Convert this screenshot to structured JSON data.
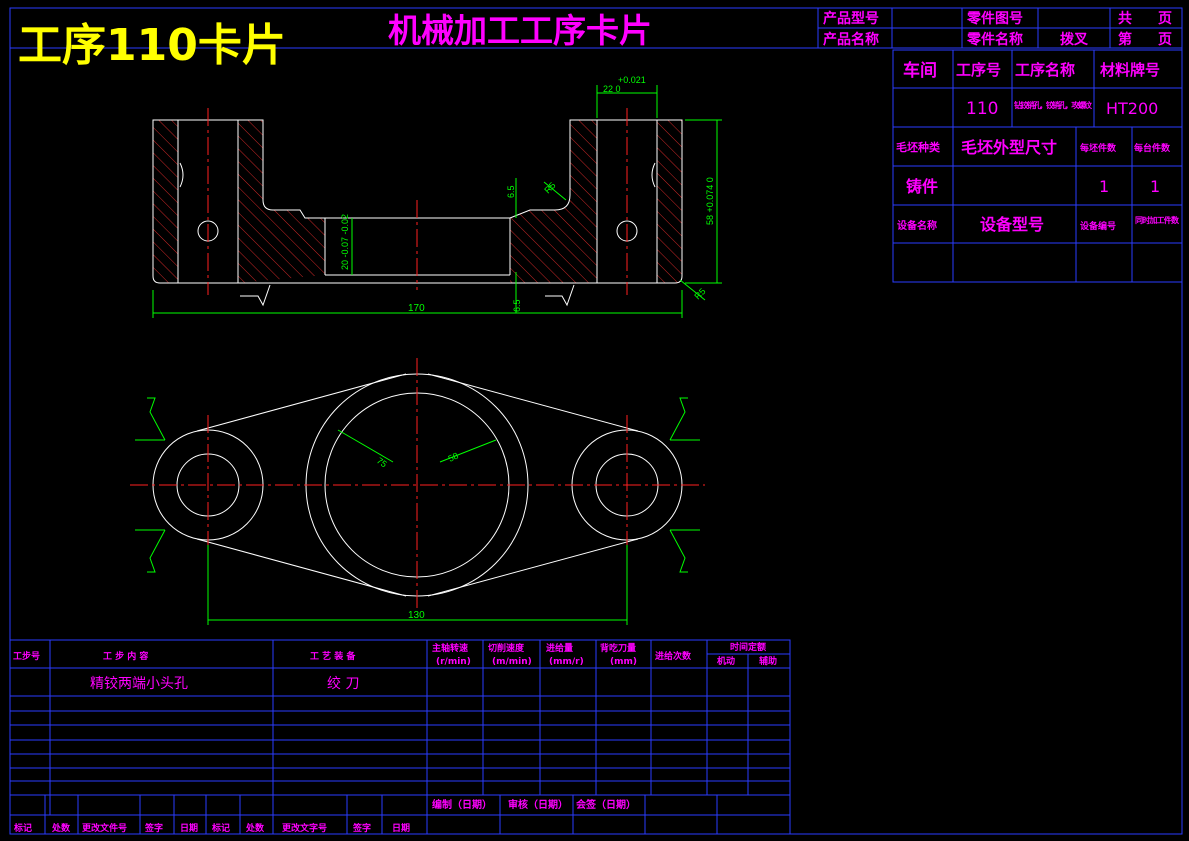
{
  "header": {
    "big_title": "工序110卡片",
    "card_title": "机械加工工序卡片",
    "product_model_label": "产品型号",
    "product_name_label": "产品名称",
    "part_drawing_no_label": "零件图号",
    "part_name_label": "零件名称",
    "part_name_value": "拨叉",
    "total_label_a": "共",
    "total_label_b": "页",
    "page_label_a": "第",
    "page_label_b": "页"
  },
  "info": {
    "workshop_label": "车间",
    "process_no_label": "工序号",
    "process_name_label": "工序名称",
    "material_label": "材料牌号",
    "process_no_value": "110",
    "process_name_value": "钻铰销孔，铰销孔，攻螺纹",
    "material_value": "HT200",
    "blank_type_label": "毛坯种类",
    "blank_size_label": "毛坯外型尺寸",
    "blanks_per_label": "每坯件数",
    "per_unit_label": "每台件数",
    "blank_type_value": "铸件",
    "blanks_per_value": "1",
    "per_unit_value": "1",
    "equipment_name_label": "设备名称",
    "equipment_model_label": "设备型号",
    "equipment_no_label": "设备编号",
    "simultaneous_label": "同时加工件数"
  },
  "drawing": {
    "dim_tol_top": "+0.021",
    "dim_22": "22  0",
    "dim_58": "58 +0.074 0",
    "dim_65a": "6.5",
    "dim_r5": "R5",
    "dim_hole": "20 -0.07 -0.02",
    "dim_r5b": "R5",
    "dim_65b": "6.5",
    "dim_170": "170",
    "dim_75": "75",
    "dim_58b": "58",
    "dim_130": "130"
  },
  "steps_table": {
    "headers": {
      "step_no": "工步号",
      "step_content": "工 步 内 容",
      "equipment": "工 艺 装 备",
      "spindle_speed": "主轴转速",
      "spindle_speed_unit": "(r/min)",
      "cutting_speed": "切削速度",
      "cutting_speed_unit": "(m/min)",
      "feed": "进给量",
      "feed_unit": "(mm/r)",
      "depth": "背吃刀量",
      "depth_unit": "(mm)",
      "passes": "进给次数",
      "time_quota": "时间定额",
      "machine": "机动",
      "auxiliary": "辅助"
    },
    "rows": [
      {
        "content": "精铰两端小头孔",
        "equipment": "绞 刀"
      }
    ]
  },
  "footer": {
    "compile": "编制（日期）",
    "review": "审核（日期）",
    "countersign": "会签（日期）",
    "mark": "标记",
    "count": "处数",
    "change_doc": "更改文件号",
    "sign": "签字",
    "date": "日期",
    "mark2": "标记",
    "count2": "处数",
    "change_doc2": "更改文字号",
    "sign2": "签字",
    "date2": "日期"
  }
}
